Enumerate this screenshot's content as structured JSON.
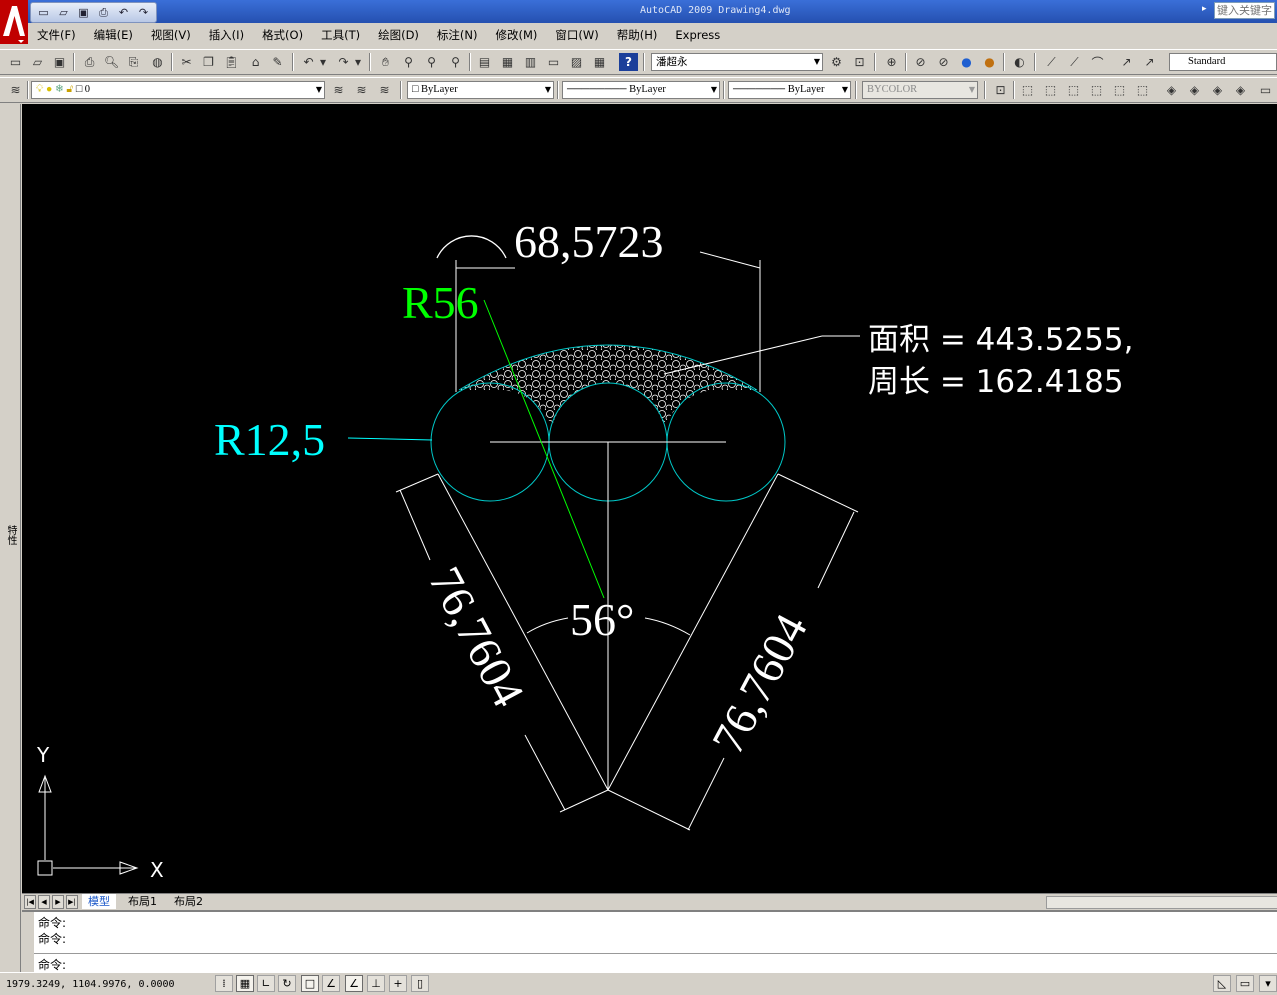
{
  "window": {
    "title": "AutoCAD 2009 Drawing4.dwg",
    "search_placeholder": "键入关键字"
  },
  "quick_access": [
    "new-icon",
    "open-icon",
    "save-icon",
    "plot-icon",
    "undo-icon",
    "redo-icon"
  ],
  "menu": [
    "文件(F)",
    "编辑(E)",
    "视图(V)",
    "插入(I)",
    "格式(O)",
    "工具(T)",
    "绘图(D)",
    "标注(N)",
    "修改(M)",
    "窗口(W)",
    "帮助(H)",
    "Express"
  ],
  "toolbar1": {
    "text_style": "潘超永",
    "dim_style": "Standard"
  },
  "toolbar2": {
    "layer": "0",
    "color": "ByLayer",
    "linetype": "ByLayer",
    "lineweight": "ByLayer",
    "plotstyle": "BYCOLOR"
  },
  "drawing": {
    "dim_top": "68,5723",
    "label_r56": "R56",
    "label_r12": "R12,5",
    "area_line": "面积 = 443.5255,",
    "perimeter_line": "周长 = 162.4185",
    "dim_left": "76,7604",
    "dim_right": "76,7604",
    "angle": "56°",
    "ucs_x": "X",
    "ucs_y": "Y"
  },
  "tabs": [
    "模型",
    "布局1",
    "布局2"
  ],
  "left_strip_label": "特性",
  "command": {
    "line1": "命令:",
    "line2": "命令:",
    "prompt": "命令:"
  },
  "status": {
    "coordinates": "1979.3249, 1104.9976, 0.0000"
  },
  "colors": {
    "canvas": "#000000",
    "white": "#ffffff",
    "green": "#00ff00",
    "cyan": "#00ffff",
    "circle": "#00c8c8"
  }
}
